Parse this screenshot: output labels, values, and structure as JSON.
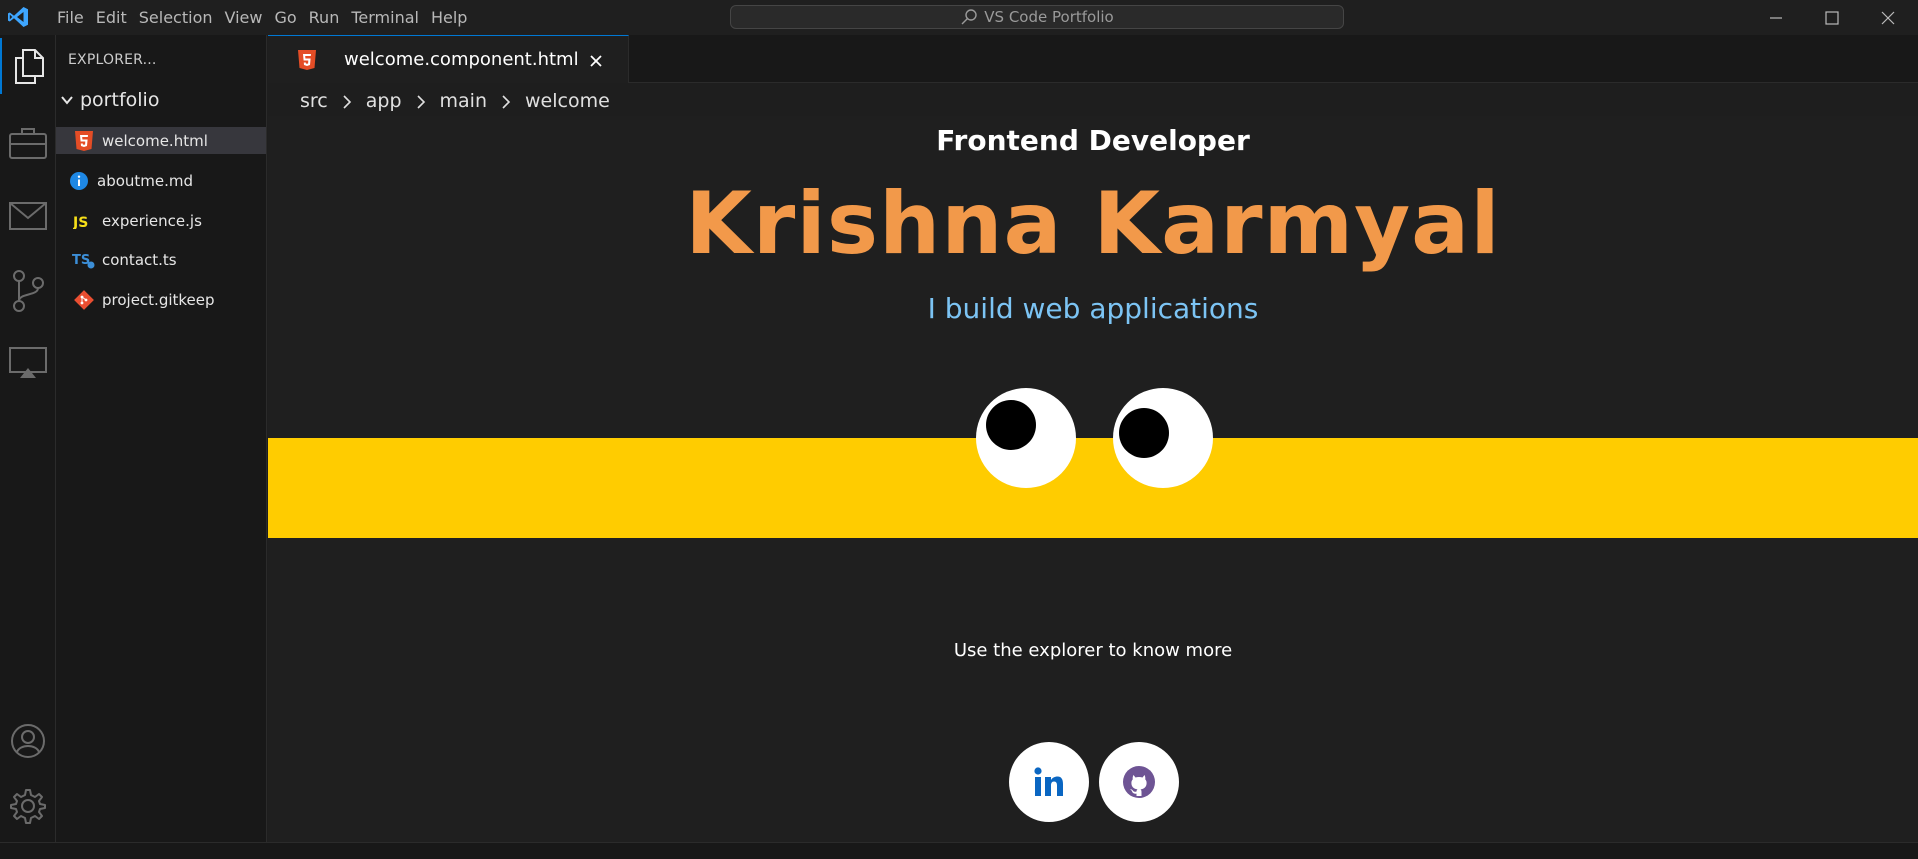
{
  "menu": [
    "File",
    "Edit",
    "Selection",
    "View",
    "Go",
    "Run",
    "Terminal",
    "Help"
  ],
  "command_center": {
    "text": "VS Code Portfolio"
  },
  "sidebar": {
    "title": "EXPLORER...",
    "folder": "portfolio",
    "files": [
      {
        "label": "welcome.html",
        "icon": "html5-icon",
        "selected": true
      },
      {
        "label": "aboutme.md",
        "icon": "info-icon",
        "selected": false
      },
      {
        "label": "experience.js",
        "icon": "javascript-icon",
        "selected": false
      },
      {
        "label": "contact.ts",
        "icon": "typescript-icon",
        "selected": false
      },
      {
        "label": "project.gitkeep",
        "icon": "git-icon",
        "selected": false
      }
    ]
  },
  "editor": {
    "tab_label": "welcome.component.html",
    "breadcrumb": [
      "src",
      "app",
      "main",
      "welcome"
    ],
    "role": "Frontend Developer",
    "name": "Krishna Karmyal",
    "tagline": "I build web applications",
    "hint": "Use the explorer to know more"
  },
  "colors": {
    "accent": "#0078d4",
    "name": "#f2994a",
    "tagline": "#7cc4f4",
    "band": "#ffcc00",
    "background": "#1f1f1f"
  },
  "social": [
    {
      "icon": "linkedin-icon"
    },
    {
      "icon": "github-icon"
    }
  ]
}
